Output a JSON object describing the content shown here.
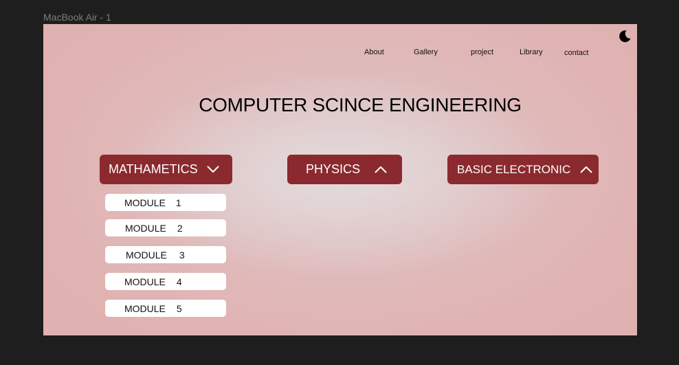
{
  "frame_label": "MacBook Air - 1",
  "nav": {
    "items": [
      "About",
      "Gallery",
      "project",
      "Library",
      "contact"
    ]
  },
  "title": "COMPUTER SCINCE ENGINEERING",
  "subjects": [
    {
      "label": "MATHAMETICS",
      "icon": "chevron-down-icon"
    },
    {
      "label": "PHYSICS",
      "icon": "chevron-up-icon"
    },
    {
      "label": "BASIC ELECTRONIC",
      "icon": "chevron-up-icon"
    }
  ],
  "modules": [
    {
      "label": "MODULE",
      "number": "1"
    },
    {
      "label": "MODULE",
      "number": "2"
    },
    {
      "label": "MODULE",
      "number": "3"
    },
    {
      "label": "MODULE",
      "number": "4"
    },
    {
      "label": "MODULE",
      "number": "5"
    }
  ],
  "theme_icon": "moon-icon",
  "colors": {
    "canvas": "#1e1e1e",
    "frame_bg": "#e0b1b1",
    "button": "#8b2a2e",
    "module_bg": "#ffffff"
  }
}
